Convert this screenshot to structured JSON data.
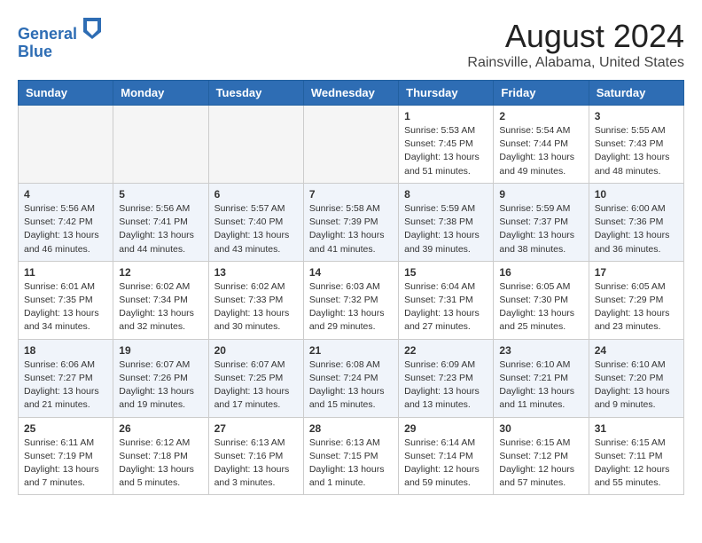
{
  "header": {
    "logo_line1": "General",
    "logo_line2": "Blue",
    "month_year": "August 2024",
    "location": "Rainsville, Alabama, United States"
  },
  "weekdays": [
    "Sunday",
    "Monday",
    "Tuesday",
    "Wednesday",
    "Thursday",
    "Friday",
    "Saturday"
  ],
  "weeks": [
    [
      {
        "day": "",
        "info": ""
      },
      {
        "day": "",
        "info": ""
      },
      {
        "day": "",
        "info": ""
      },
      {
        "day": "",
        "info": ""
      },
      {
        "day": "1",
        "info": "Sunrise: 5:53 AM\nSunset: 7:45 PM\nDaylight: 13 hours\nand 51 minutes."
      },
      {
        "day": "2",
        "info": "Sunrise: 5:54 AM\nSunset: 7:44 PM\nDaylight: 13 hours\nand 49 minutes."
      },
      {
        "day": "3",
        "info": "Sunrise: 5:55 AM\nSunset: 7:43 PM\nDaylight: 13 hours\nand 48 minutes."
      }
    ],
    [
      {
        "day": "4",
        "info": "Sunrise: 5:56 AM\nSunset: 7:42 PM\nDaylight: 13 hours\nand 46 minutes."
      },
      {
        "day": "5",
        "info": "Sunrise: 5:56 AM\nSunset: 7:41 PM\nDaylight: 13 hours\nand 44 minutes."
      },
      {
        "day": "6",
        "info": "Sunrise: 5:57 AM\nSunset: 7:40 PM\nDaylight: 13 hours\nand 43 minutes."
      },
      {
        "day": "7",
        "info": "Sunrise: 5:58 AM\nSunset: 7:39 PM\nDaylight: 13 hours\nand 41 minutes."
      },
      {
        "day": "8",
        "info": "Sunrise: 5:59 AM\nSunset: 7:38 PM\nDaylight: 13 hours\nand 39 minutes."
      },
      {
        "day": "9",
        "info": "Sunrise: 5:59 AM\nSunset: 7:37 PM\nDaylight: 13 hours\nand 38 minutes."
      },
      {
        "day": "10",
        "info": "Sunrise: 6:00 AM\nSunset: 7:36 PM\nDaylight: 13 hours\nand 36 minutes."
      }
    ],
    [
      {
        "day": "11",
        "info": "Sunrise: 6:01 AM\nSunset: 7:35 PM\nDaylight: 13 hours\nand 34 minutes."
      },
      {
        "day": "12",
        "info": "Sunrise: 6:02 AM\nSunset: 7:34 PM\nDaylight: 13 hours\nand 32 minutes."
      },
      {
        "day": "13",
        "info": "Sunrise: 6:02 AM\nSunset: 7:33 PM\nDaylight: 13 hours\nand 30 minutes."
      },
      {
        "day": "14",
        "info": "Sunrise: 6:03 AM\nSunset: 7:32 PM\nDaylight: 13 hours\nand 29 minutes."
      },
      {
        "day": "15",
        "info": "Sunrise: 6:04 AM\nSunset: 7:31 PM\nDaylight: 13 hours\nand 27 minutes."
      },
      {
        "day": "16",
        "info": "Sunrise: 6:05 AM\nSunset: 7:30 PM\nDaylight: 13 hours\nand 25 minutes."
      },
      {
        "day": "17",
        "info": "Sunrise: 6:05 AM\nSunset: 7:29 PM\nDaylight: 13 hours\nand 23 minutes."
      }
    ],
    [
      {
        "day": "18",
        "info": "Sunrise: 6:06 AM\nSunset: 7:27 PM\nDaylight: 13 hours\nand 21 minutes."
      },
      {
        "day": "19",
        "info": "Sunrise: 6:07 AM\nSunset: 7:26 PM\nDaylight: 13 hours\nand 19 minutes."
      },
      {
        "day": "20",
        "info": "Sunrise: 6:07 AM\nSunset: 7:25 PM\nDaylight: 13 hours\nand 17 minutes."
      },
      {
        "day": "21",
        "info": "Sunrise: 6:08 AM\nSunset: 7:24 PM\nDaylight: 13 hours\nand 15 minutes."
      },
      {
        "day": "22",
        "info": "Sunrise: 6:09 AM\nSunset: 7:23 PM\nDaylight: 13 hours\nand 13 minutes."
      },
      {
        "day": "23",
        "info": "Sunrise: 6:10 AM\nSunset: 7:21 PM\nDaylight: 13 hours\nand 11 minutes."
      },
      {
        "day": "24",
        "info": "Sunrise: 6:10 AM\nSunset: 7:20 PM\nDaylight: 13 hours\nand 9 minutes."
      }
    ],
    [
      {
        "day": "25",
        "info": "Sunrise: 6:11 AM\nSunset: 7:19 PM\nDaylight: 13 hours\nand 7 minutes."
      },
      {
        "day": "26",
        "info": "Sunrise: 6:12 AM\nSunset: 7:18 PM\nDaylight: 13 hours\nand 5 minutes."
      },
      {
        "day": "27",
        "info": "Sunrise: 6:13 AM\nSunset: 7:16 PM\nDaylight: 13 hours\nand 3 minutes."
      },
      {
        "day": "28",
        "info": "Sunrise: 6:13 AM\nSunset: 7:15 PM\nDaylight: 13 hours\nand 1 minute."
      },
      {
        "day": "29",
        "info": "Sunrise: 6:14 AM\nSunset: 7:14 PM\nDaylight: 12 hours\nand 59 minutes."
      },
      {
        "day": "30",
        "info": "Sunrise: 6:15 AM\nSunset: 7:12 PM\nDaylight: 12 hours\nand 57 minutes."
      },
      {
        "day": "31",
        "info": "Sunrise: 6:15 AM\nSunset: 7:11 PM\nDaylight: 12 hours\nand 55 minutes."
      }
    ]
  ]
}
